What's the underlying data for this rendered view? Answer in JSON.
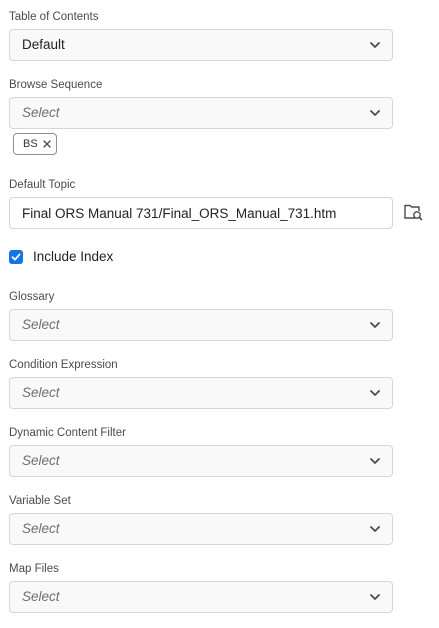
{
  "toc": {
    "label": "Table of Contents",
    "value": "Default"
  },
  "browse_sequence": {
    "label": "Browse Sequence",
    "placeholder": "Select",
    "tags": [
      "BS"
    ]
  },
  "default_topic": {
    "label": "Default Topic",
    "value": "Final ORS Manual 731/Final_ORS_Manual_731.htm",
    "browse_icon": "folder-search-icon"
  },
  "include_index": {
    "label": "Include Index",
    "checked": true
  },
  "glossary": {
    "label": "Glossary",
    "placeholder": "Select"
  },
  "condition_expression": {
    "label": "Condition Expression",
    "placeholder": "Select"
  },
  "dynamic_content_filter": {
    "label": "Dynamic Content Filter",
    "placeholder": "Select"
  },
  "variable_set": {
    "label": "Variable Set",
    "placeholder": "Select"
  },
  "map_files": {
    "label": "Map Files",
    "placeholder": "Select"
  },
  "colors": {
    "accent": "#1473e6",
    "field_border": "#d6d6d6",
    "field_bg": "#f9f9f9"
  }
}
